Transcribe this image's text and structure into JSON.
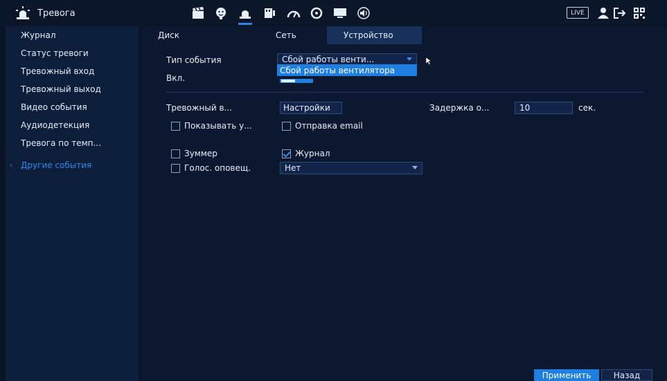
{
  "app": {
    "title": "Тревога",
    "live_label": "LIVE"
  },
  "top_icons": [
    "clapperboard-icon",
    "face-icon",
    "alarm-icon",
    "network-icon",
    "speedometer-icon",
    "disc-icon",
    "monitor-icon",
    "speaker-icon",
    "user-icon",
    "logout-icon",
    "qr-code-icon"
  ],
  "sidebar": {
    "items": [
      {
        "label": "Журнал"
      },
      {
        "label": "Статус тревоги"
      },
      {
        "label": "Тревожный вход"
      },
      {
        "label": "Тревожный выход"
      },
      {
        "label": "Видео события"
      },
      {
        "label": "Аудиодетекция"
      },
      {
        "label": "Тревога по темп..."
      },
      {
        "label": "Другие события",
        "active": true
      }
    ]
  },
  "tabs": [
    {
      "label": "Диск"
    },
    {
      "label": "Сеть"
    },
    {
      "label": "Устройство",
      "active": true
    }
  ],
  "form": {
    "event_type_label": "Тип события",
    "event_type_value": "Сбой работы венти...",
    "event_type_option": "Сбой работы вентилятора",
    "enable_label": "Вкл.",
    "alarm_out_label": "Тревожный в...",
    "settings_button": "Настройки",
    "delay_label": "Задержка о...",
    "delay_value": "10",
    "delay_unit": "сек.",
    "show_message_label": "Показывать у...",
    "send_email_label": "Отправка email",
    "buzzer_label": "Зуммер",
    "log_label": "Журнал",
    "voice_label": "Голос. оповещ.",
    "voice_value": "Нет"
  },
  "checkbox_states": {
    "show_message": false,
    "send_email": false,
    "buzzer": false,
    "log": true,
    "voice": false
  },
  "buttons": {
    "apply": "Применить",
    "back": "Назад"
  },
  "colors": {
    "accent": "#1e7fe0",
    "active_text": "#2e8cf0"
  }
}
